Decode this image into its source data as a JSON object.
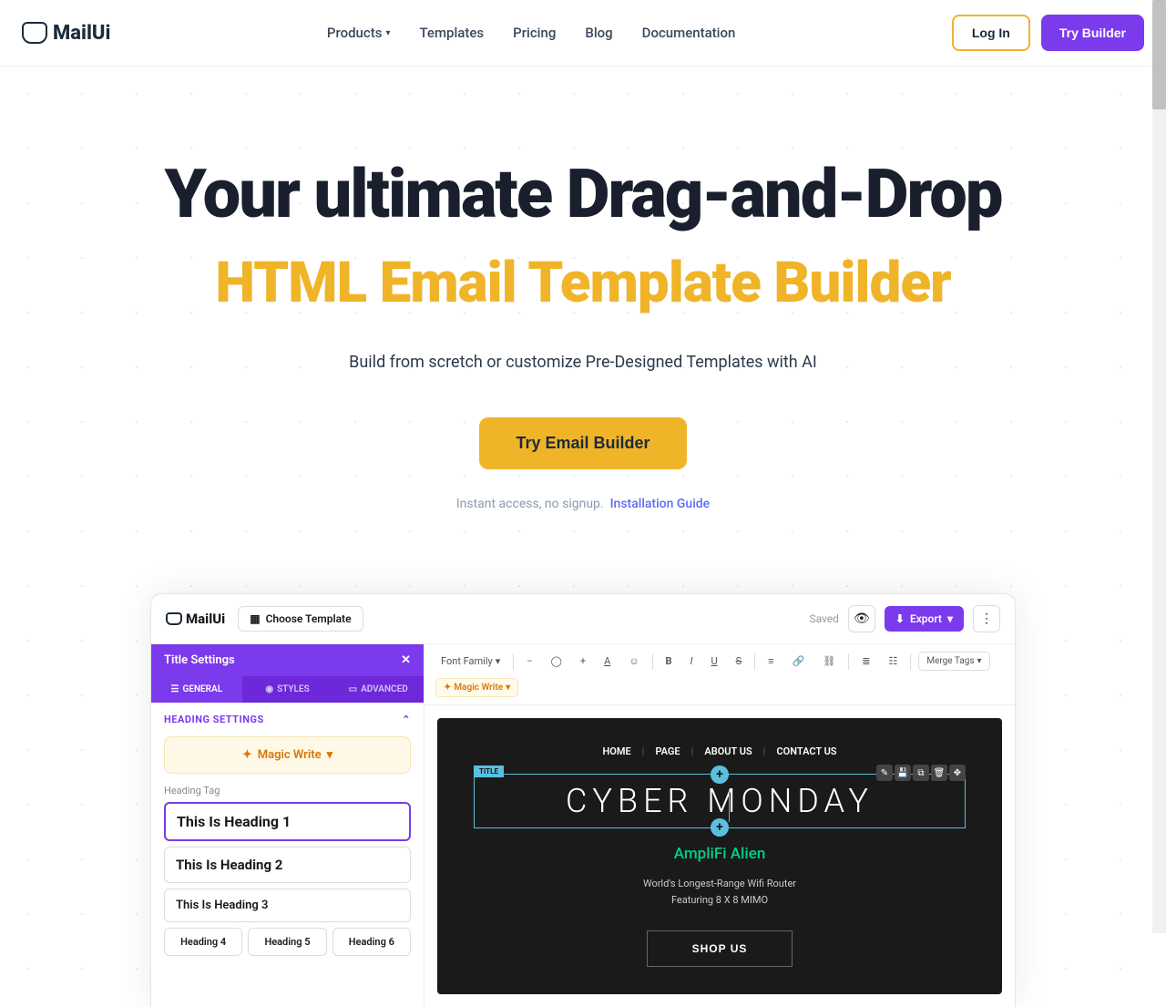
{
  "header": {
    "logo": "MailUi",
    "nav": [
      "Products",
      "Templates",
      "Pricing",
      "Blog",
      "Documentation"
    ],
    "login": "Log In",
    "try": "Try Builder"
  },
  "hero": {
    "title1": "Your ultimate Drag-and-Drop",
    "title2": "HTML Email Template Builder",
    "sub": "Build from scretch or customize Pre-Designed Templates with AI",
    "cta": "Try Email Builder",
    "foot_text": "Instant access, no signup.",
    "foot_link": "Installation Guide"
  },
  "builder": {
    "logo": "MailUi",
    "choose": "Choose Template",
    "saved": "Saved",
    "export": "Export",
    "side_title": "Title Settings",
    "tabs": [
      "GENERAL",
      "STYLES",
      "ADVANCED"
    ],
    "section": "HEADING SETTINGS",
    "magic_write": "Magic Write",
    "heading_tag_label": "Heading Tag",
    "heading_opts": [
      "This Is Heading 1",
      "This Is Heading 2",
      "This Is Heading 3"
    ],
    "heading_chips": [
      "Heading 4",
      "Heading 5",
      "Heading 6"
    ],
    "toolbar": {
      "font_family": "Font Family",
      "merge": "Merge Tags",
      "magic": "Magic Write"
    },
    "canvas": {
      "nav": [
        "HOME",
        "PAGE",
        "ABOUT US",
        "CONTACT US"
      ],
      "title_tag": "TITLE",
      "cyber": "CYBER MONDAY",
      "amp": "AmpliFi Alien",
      "desc1": "World's Longest-Range Wifi Router",
      "desc2": "Featuring 8 X 8 MIMO",
      "shop": "SHOP US"
    }
  }
}
